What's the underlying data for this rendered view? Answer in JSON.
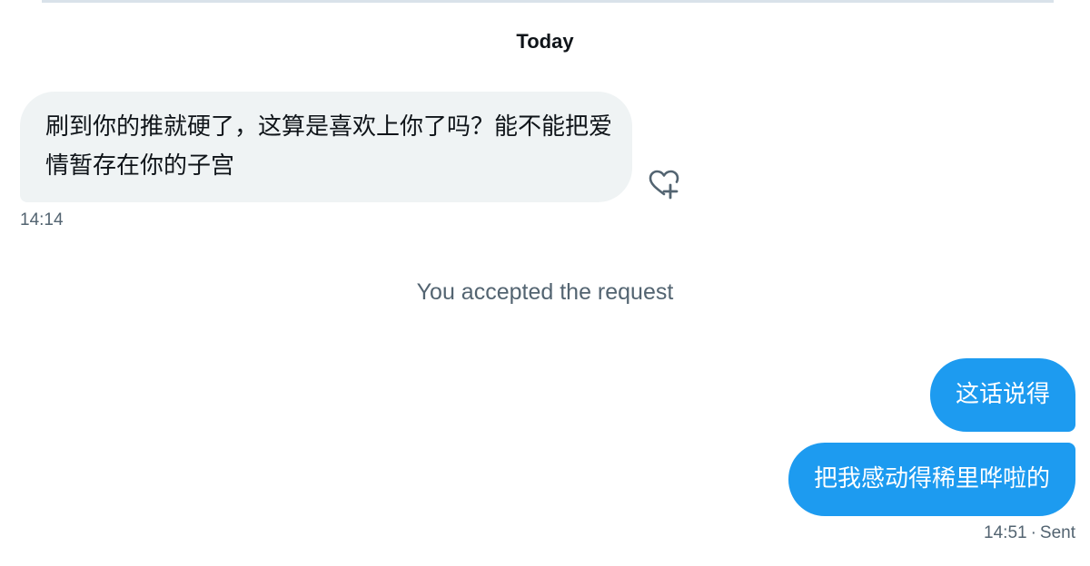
{
  "conversation": {
    "date_header": "Today",
    "received_message": {
      "text": "刷到你的推就硬了，这算是喜欢上你了吗？能不能把爱情暂存在你的子宫",
      "time": "14:14",
      "react_icon": "heart-plus-icon"
    },
    "system_note": "You accepted the request",
    "sent_messages": [
      {
        "text": "这话说得"
      },
      {
        "text": "把我感动得稀里哗啦的"
      }
    ],
    "sent_meta": {
      "time": "14:51",
      "separator": "·",
      "status": "Sent"
    }
  },
  "colors": {
    "sent_bubble": "#1d9bf0",
    "received_bubble": "#eff3f4",
    "secondary_text": "#536471",
    "primary_text": "#0f1419"
  }
}
